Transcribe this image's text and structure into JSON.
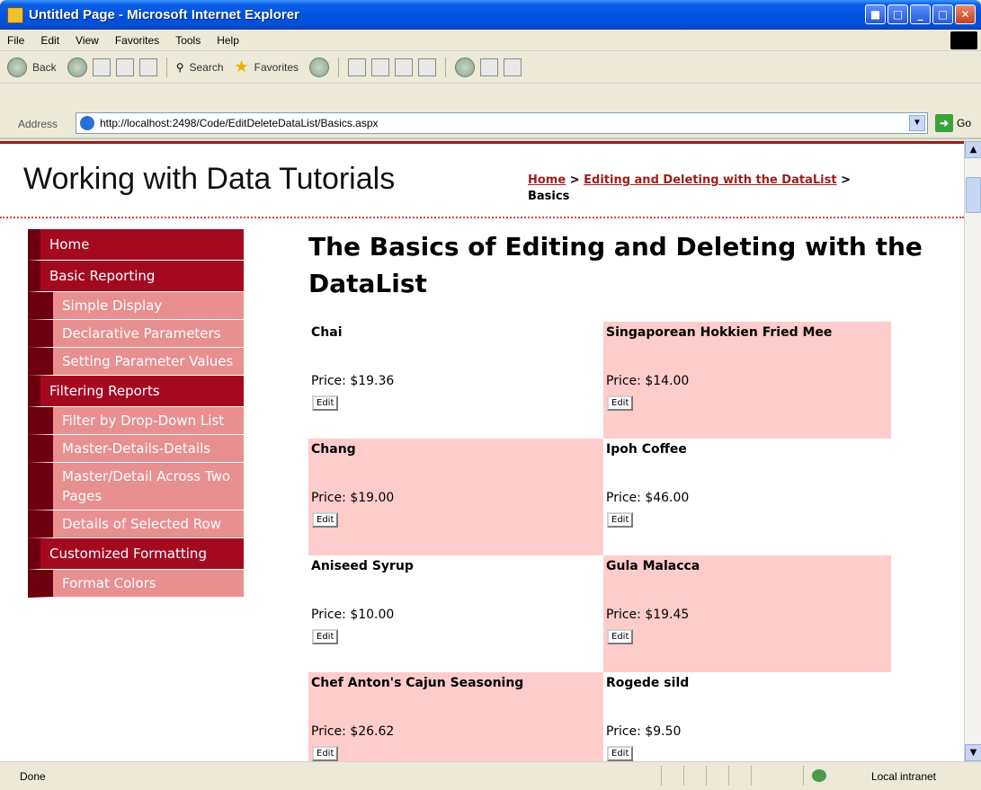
{
  "window": {
    "title": "Untitled Page - Microsoft Internet Explorer"
  },
  "menu": [
    "File",
    "Edit",
    "View",
    "Favorites",
    "Tools",
    "Help"
  ],
  "toolbar": {
    "back_label": "Back",
    "search_label": "Search",
    "favorites_label": "Favorites"
  },
  "address": {
    "label": "Address",
    "url": "http://localhost:2498/Code/EditDeleteDataList/Basics.aspx",
    "go_label": "Go"
  },
  "page": {
    "site_title": "Working with Data Tutorials",
    "breadcrumb": {
      "home": "Home",
      "sep1": " > ",
      "parent": "Editing and Deleting with the DataList",
      "sep2": " > ",
      "current": "Basics"
    },
    "heading": "The Basics of Editing and Deleting with the DataList",
    "nav": [
      {
        "label": "Home",
        "type": "section"
      },
      {
        "label": "Basic Reporting",
        "type": "section"
      },
      {
        "label": "Simple Display",
        "type": "sub"
      },
      {
        "label": "Declarative Parameters",
        "type": "sub"
      },
      {
        "label": "Setting Parameter Values",
        "type": "sub"
      },
      {
        "label": "Filtering Reports",
        "type": "section"
      },
      {
        "label": "Filter by Drop-Down List",
        "type": "sub"
      },
      {
        "label": "Master-Details-Details",
        "type": "sub"
      },
      {
        "label": "Master/Detail Across Two Pages",
        "type": "sub"
      },
      {
        "label": "Details of Selected Row",
        "type": "sub"
      },
      {
        "label": "Customized Formatting",
        "type": "section"
      },
      {
        "label": "Format Colors",
        "type": "sub"
      }
    ],
    "products": [
      {
        "name": "Chai",
        "price": "Price: $19.36",
        "edit": "Edit",
        "pink": false
      },
      {
        "name": "Singaporean Hokkien Fried Mee",
        "price": "Price: $14.00",
        "edit": "Edit",
        "pink": true
      },
      {
        "name": "Chang",
        "price": "Price: $19.00",
        "edit": "Edit",
        "pink": true
      },
      {
        "name": "Ipoh Coffee",
        "price": "Price: $46.00",
        "edit": "Edit",
        "pink": false
      },
      {
        "name": "Aniseed Syrup",
        "price": "Price: $10.00",
        "edit": "Edit",
        "pink": false
      },
      {
        "name": "Gula Malacca",
        "price": "Price: $19.45",
        "edit": "Edit",
        "pink": true
      },
      {
        "name": "Chef Anton's Cajun Seasoning",
        "price": "Price: $26.62",
        "edit": "Edit",
        "pink": true
      },
      {
        "name": "Rogede sild",
        "price": "Price: $9.50",
        "edit": "Edit",
        "pink": false
      }
    ]
  },
  "status": {
    "left": "Done",
    "zone": "Local intranet"
  },
  "colors": {
    "accent": "#a30a20",
    "nav_sub": "#e88f8f",
    "alt_row": "#ffcccc"
  }
}
